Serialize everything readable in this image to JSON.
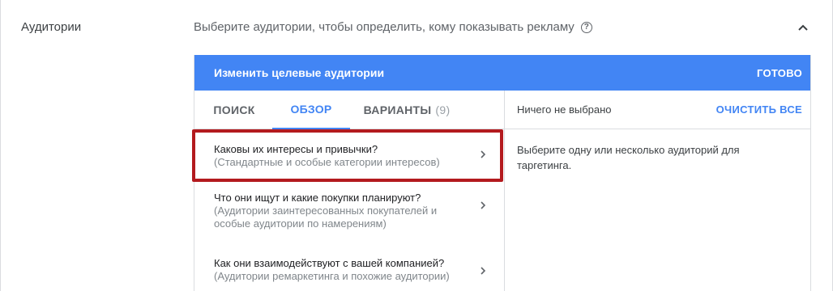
{
  "section": {
    "label": "Аудитории",
    "description": "Выберите аудитории, чтобы определить, кому показывать рекламу"
  },
  "icons": {
    "help": "help-circle-icon",
    "collapse": "chevron-up-icon",
    "item_arrow": "chevron-right-icon"
  },
  "panel": {
    "title": "Изменить целевые аудитории",
    "done_label": "ГОТОВО",
    "header_color": "#4285f4"
  },
  "tabs": [
    {
      "label": "ПОИСК",
      "active": false
    },
    {
      "label": "ОБЗОР",
      "active": true
    },
    {
      "label": "ВАРИАНТЫ",
      "count": "(9)",
      "active": false
    }
  ],
  "categories": [
    {
      "title": "Каковы их интересы и привычки?",
      "subtitle": "(Стандартные и особые категории интересов)",
      "highlighted": true
    },
    {
      "title": "Что они ищут и какие покупки планируют?",
      "subtitle": "(Аудитории заинтересованных покупателей и особые аудитории по намерениям)"
    },
    {
      "title": "Как они взаимодействуют с вашей компанией?",
      "subtitle": "(Аудитории ремаркетинга и похожие аудитории)"
    }
  ],
  "selection": {
    "status": "Ничего не выбрано",
    "clear_label": "ОЧИСТИТЬ ВСЕ",
    "hint": "Выберите одну или несколько аудиторий для таргетинга."
  },
  "colors": {
    "accent": "#4285f4",
    "highlight_border": "#b31a1e"
  }
}
